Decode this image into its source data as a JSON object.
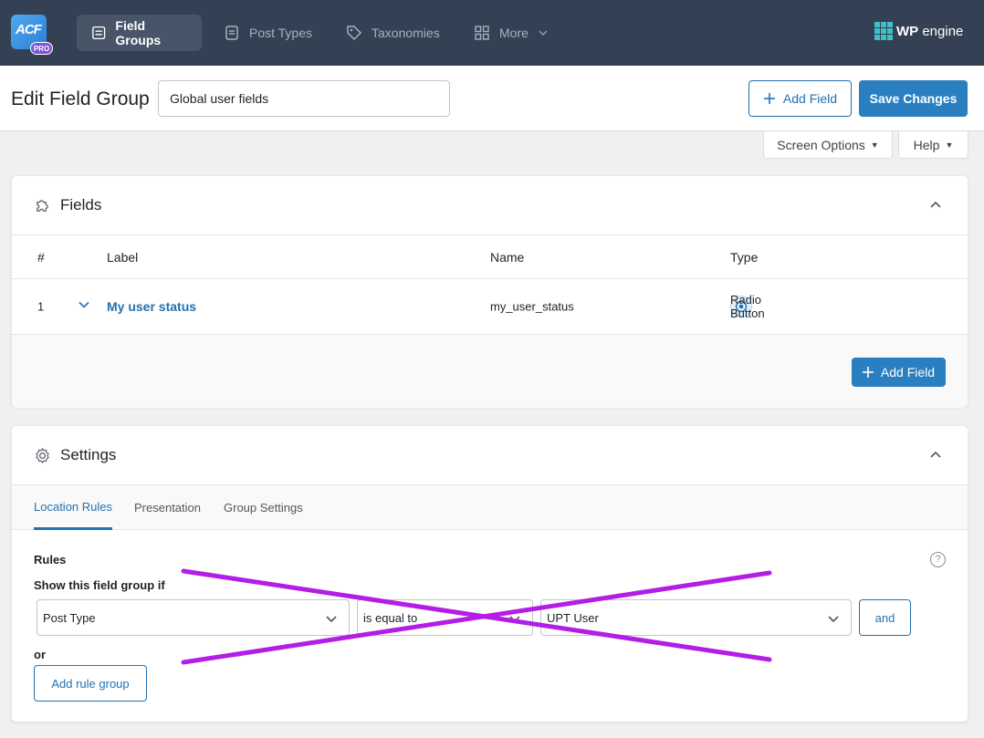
{
  "nav": {
    "logo_text": "ACF",
    "logo_badge": "PRO",
    "tabs": [
      {
        "label": "Field Groups",
        "icon": "list-icon",
        "active": true
      },
      {
        "label": "Post Types",
        "icon": "document-icon",
        "active": false
      },
      {
        "label": "Taxonomies",
        "icon": "tag-icon",
        "active": false
      },
      {
        "label": "More",
        "icon": "grid-icon",
        "active": false
      }
    ],
    "partner_bold": "WP",
    "partner_rest": "engine"
  },
  "header": {
    "title": "Edit Field Group",
    "group_name_value": "Global user fields",
    "add_field_label": "Add Field",
    "save_label": "Save Changes"
  },
  "screen_meta": {
    "screen_options_label": "Screen Options",
    "help_label": "Help"
  },
  "fields_panel": {
    "title": "Fields",
    "columns": [
      "#",
      "Label",
      "Name",
      "Type"
    ],
    "rows": [
      {
        "order": "1",
        "label": "My user status",
        "name": "my_user_status",
        "type": "Radio Button"
      }
    ],
    "add_field_label": "Add Field"
  },
  "settings_panel": {
    "title": "Settings",
    "tabs": [
      "Location Rules",
      "Presentation",
      "Group Settings"
    ],
    "active_tab": "Location Rules",
    "rules_heading": "Rules",
    "show_if_label": "Show this field group if",
    "rule": {
      "param": "Post Type",
      "operator": "is equal to",
      "value": "UPT User"
    },
    "and_label": "and",
    "or_label": "or",
    "add_rule_group_label": "Add rule group",
    "help_glyph": "?"
  },
  "colors": {
    "nav_bg": "#344154",
    "accent": "#2271b1",
    "primary_btn": "#2a7fc0",
    "strike": "#b31de6"
  }
}
